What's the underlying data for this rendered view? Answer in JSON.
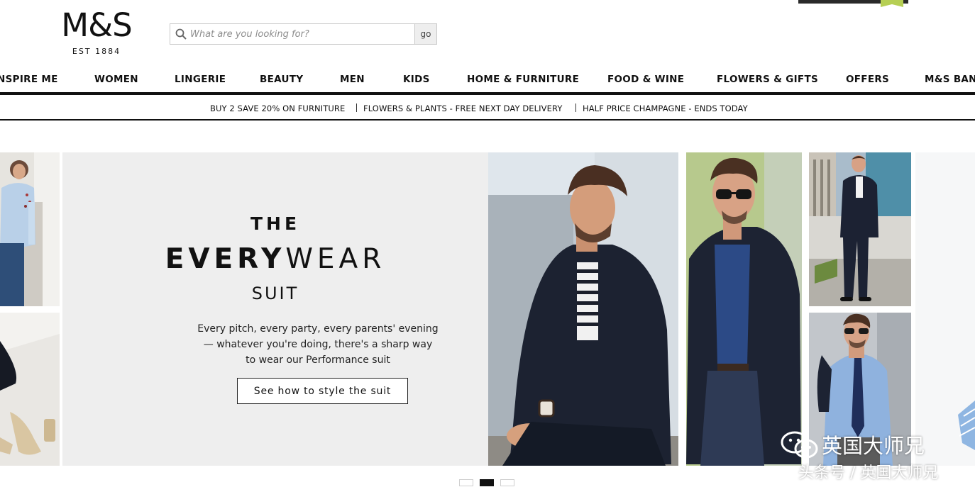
{
  "header": {
    "logo": {
      "mark": "M&S",
      "est": "EST 1884"
    },
    "search": {
      "placeholder": "What are you looking for?",
      "button": "go"
    }
  },
  "nav": {
    "items": [
      "NSPIRE ME",
      "WOMEN",
      "LINGERIE",
      "BEAUTY",
      "MEN",
      "KIDS",
      "HOME & FURNITURE",
      "FOOD & WINE",
      "FLOWERS & GIFTS",
      "OFFERS",
      "M&S BANK"
    ]
  },
  "promo": {
    "items": [
      "BUY 2 SAVE 20% ON FURNITURE",
      "FLOWERS & PLANTS - FREE NEXT DAY DELIVERY",
      "HALF PRICE CHAMPAGNE - ENDS TODAY"
    ]
  },
  "hero": {
    "the": "THE",
    "every_bold": "EVERY",
    "every_light": "WEAR",
    "suit": "SUIT",
    "copy": "Every pitch, every party, every parents' evening — whatever you're doing, there's a sharp way to wear our Performance suit",
    "cta": "See how to style the suit"
  },
  "carousel": {
    "slides": 3,
    "active": 2
  },
  "watermark": {
    "name": "英国大师兄",
    "sub": "头条号 / 英国大师兄"
  },
  "colors": {
    "panel_bg": "#eeeeee",
    "suit_navy": "#1d2433",
    "text": "#111111"
  }
}
